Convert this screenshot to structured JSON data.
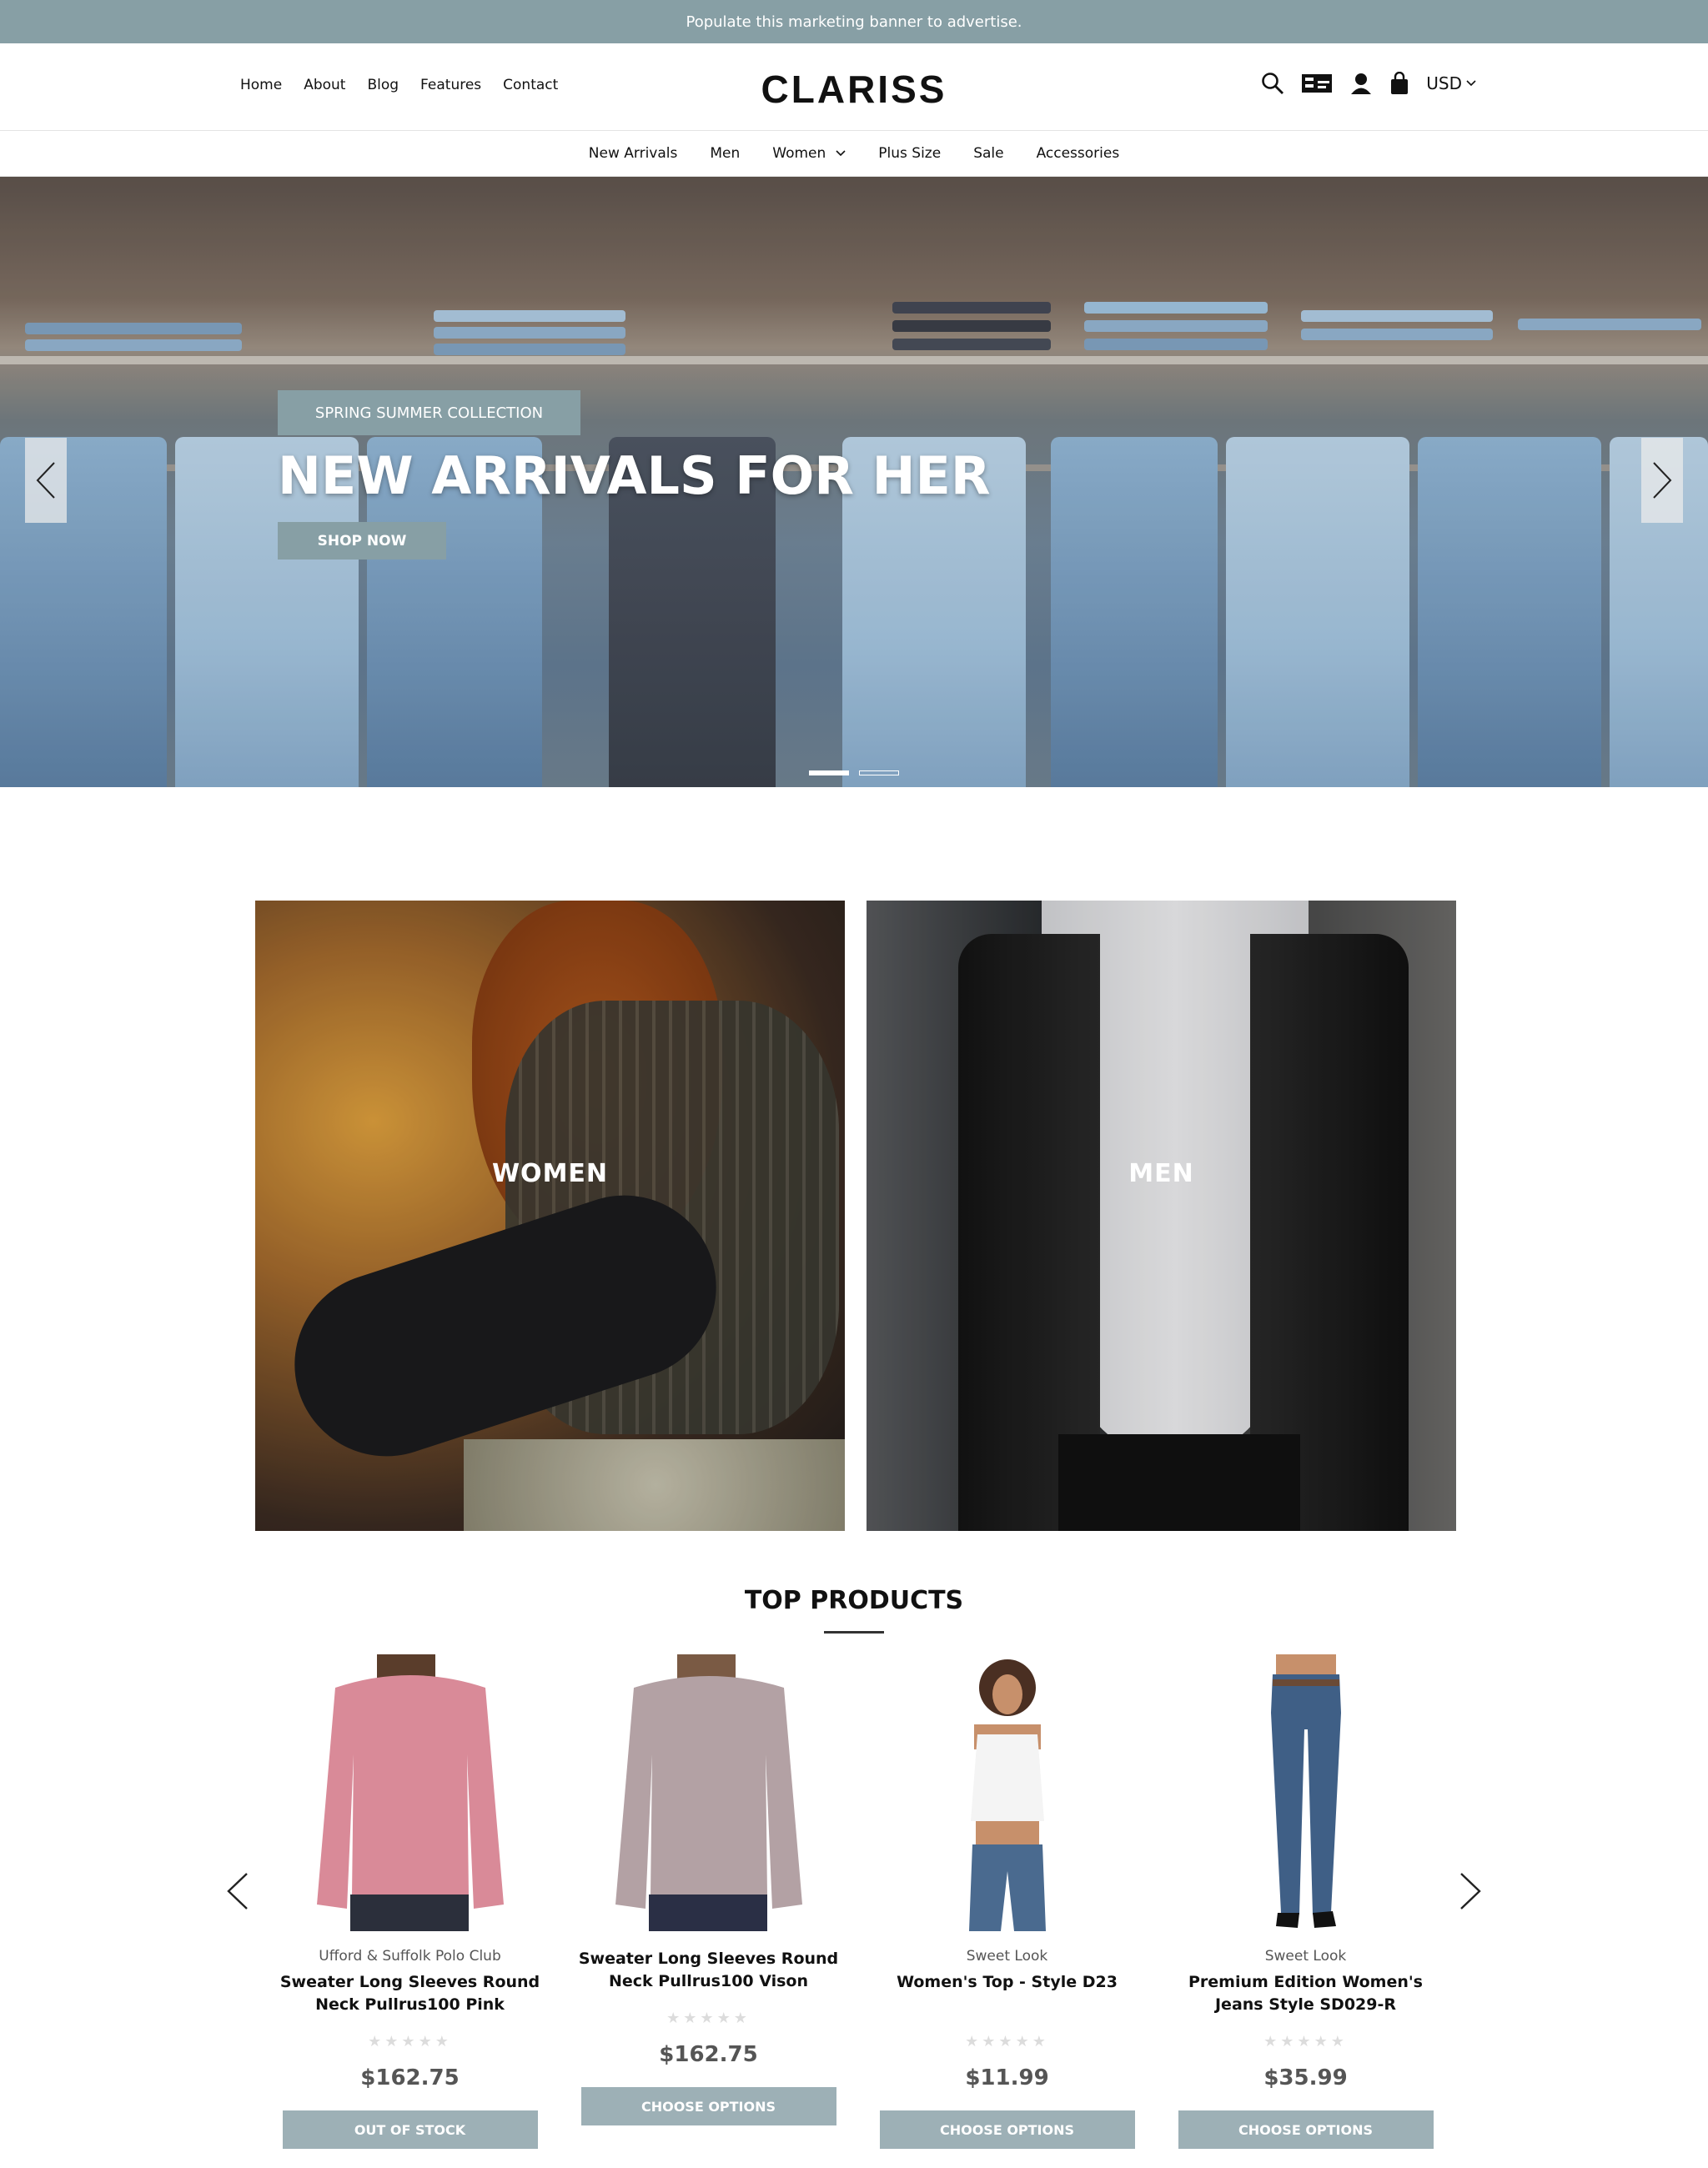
{
  "banner": {
    "text": "Populate this marketing banner to advertise."
  },
  "header": {
    "links": [
      "Home",
      "About",
      "Blog",
      "Features",
      "Contact"
    ],
    "logo": "CLARISS",
    "currency": "USD"
  },
  "nav": {
    "items": [
      "New Arrivals",
      "Men",
      "Women",
      "Plus Size",
      "Sale",
      "Accessories"
    ]
  },
  "hero": {
    "badge": "SPRING SUMMER COLLECTION",
    "title": "NEW ARRIVALS FOR HER",
    "cta": "SHOP NOW"
  },
  "categories": [
    {
      "label": "WOMEN"
    },
    {
      "label": "MEN"
    }
  ],
  "top_products": {
    "title": "TOP PRODUCTS",
    "items": [
      {
        "brand": "Ufford & Suffolk Polo Club",
        "name": "Sweater Long Sleeves Round Neck Pullrus100 Pink",
        "rating": 0,
        "price": "$162.75",
        "button": "OUT OF STOCK"
      },
      {
        "brand": "",
        "name": "Sweater Long Sleeves Round Neck Pullrus100 Vison",
        "rating": 0,
        "price": "$162.75",
        "button": "CHOOSE OPTIONS"
      },
      {
        "brand": "Sweet Look",
        "name": "Women's Top - Style D23",
        "rating": 0,
        "price": "$11.99",
        "button": "CHOOSE OPTIONS"
      },
      {
        "brand": "Sweet Look",
        "name": "Premium Edition Women's Jeans Style SD029-R",
        "rating": 0,
        "price": "$35.99",
        "button": "CHOOSE OPTIONS"
      }
    ]
  },
  "icons": {
    "search": "search-icon",
    "compare": "compare-icon",
    "account": "user-icon",
    "cart": "shopping-bag-icon"
  },
  "colors": {
    "accent": "#879fa5",
    "button": "#9db0b6"
  }
}
